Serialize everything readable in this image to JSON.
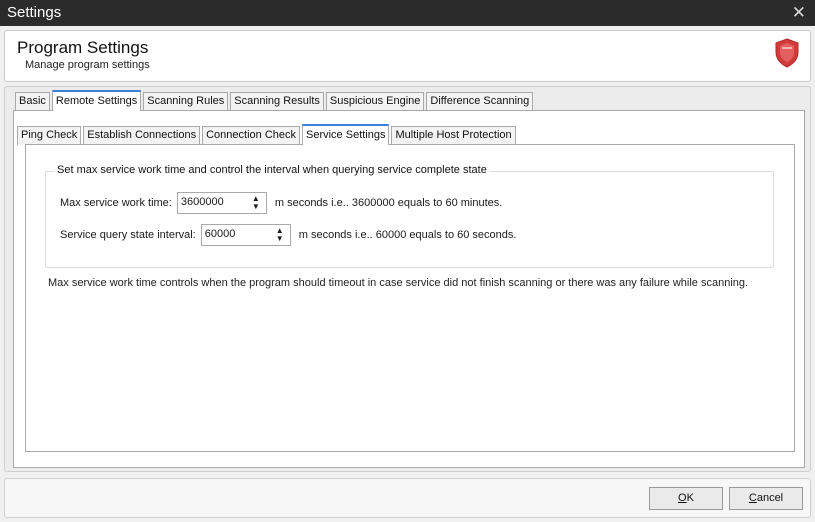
{
  "window": {
    "title": "Settings",
    "close_glyph": "✕"
  },
  "header": {
    "title": "Program Settings",
    "subtitle": "Manage program settings",
    "icon": "shield-icon",
    "icon_color": "#d23b3b"
  },
  "outer_tabs": [
    "Basic",
    "Remote Settings",
    "Scanning Rules",
    "Scanning Results",
    "Suspicious Engine",
    "Difference Scanning"
  ],
  "outer_active": "Remote Settings",
  "inner_tabs": [
    "Ping Check",
    "Establish Connections",
    "Connection Check",
    "Service Settings",
    "Multiple Host Protection"
  ],
  "inner_active": "Service Settings",
  "group": {
    "legend": "Set max service work time and control the interval when querying service complete state",
    "max_work": {
      "label": "Max service work time:",
      "value": "3600000",
      "note": "m seconds i.e.. 3600000 equals to 60 minutes."
    },
    "query_interval": {
      "label": "Service query state interval:",
      "value": "60000",
      "note": "m seconds i.e.. 60000 equals to 60 seconds."
    }
  },
  "description": "Max service work time controls when the program should timeout in case service did not finish scanning or there was any failure while scanning.",
  "buttons": {
    "ok": {
      "mnemonic": "O",
      "rest": "K"
    },
    "cancel": {
      "mnemonic": "C",
      "rest": "ancel"
    }
  },
  "accent_color": "#3d82d8"
}
